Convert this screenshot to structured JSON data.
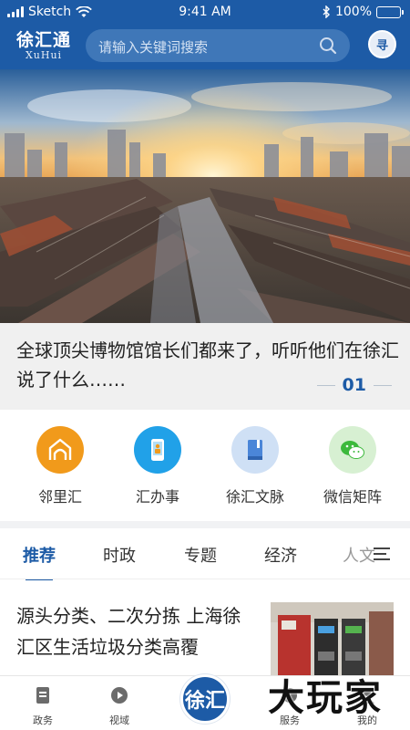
{
  "status_bar": {
    "carrier": "Sketch",
    "time": "9:41 AM",
    "battery": "100%",
    "battery_level": 1.0
  },
  "header": {
    "app_name": "徐汇通",
    "app_name_en": "XuHui",
    "search_placeholder": "请输入关键词搜索",
    "avatar_text": "寻"
  },
  "banner": {
    "image": "aerial-view-of-old-shanghai-lane-houses-at-sunset"
  },
  "headline": {
    "text": "全球顶尖博物馆馆长们都来了，听听他们在徐汇说了什么……",
    "page": "01"
  },
  "quick_entries": [
    {
      "label": "邻里汇",
      "icon": "house-arch-icon",
      "color": "#f19a1b"
    },
    {
      "label": "汇办事",
      "icon": "phone-id-icon",
      "color": "#21a1e8"
    },
    {
      "label": "徐汇文脉",
      "icon": "book-icon",
      "color": "#4b86d8"
    },
    {
      "label": "微信矩阵",
      "icon": "wechat-icon",
      "color": "#3cb93c"
    }
  ],
  "tabs": [
    {
      "label": "推荐",
      "active": true
    },
    {
      "label": "时政",
      "active": false
    },
    {
      "label": "专题",
      "active": false
    },
    {
      "label": "经济",
      "active": false
    },
    {
      "label": "人文",
      "active": false
    }
  ],
  "article": {
    "title": "源头分类、二次分拣  上海徐汇区生活垃圾分类高覆",
    "thumb": "waste-sorting-bins-photo"
  },
  "bottom_nav": [
    {
      "label": "政务",
      "icon": "document-icon"
    },
    {
      "label": "视域",
      "icon": "play-icon"
    },
    {
      "label": "徐汇",
      "icon": "xuhui-logo-icon"
    },
    {
      "label": "服务",
      "icon": "service-icon"
    },
    {
      "label": "我的",
      "icon": "profile-icon"
    }
  ],
  "watermark": "大玩家",
  "colors": {
    "brand": "#1d5ba6",
    "search_bg": "#3f77b8"
  }
}
